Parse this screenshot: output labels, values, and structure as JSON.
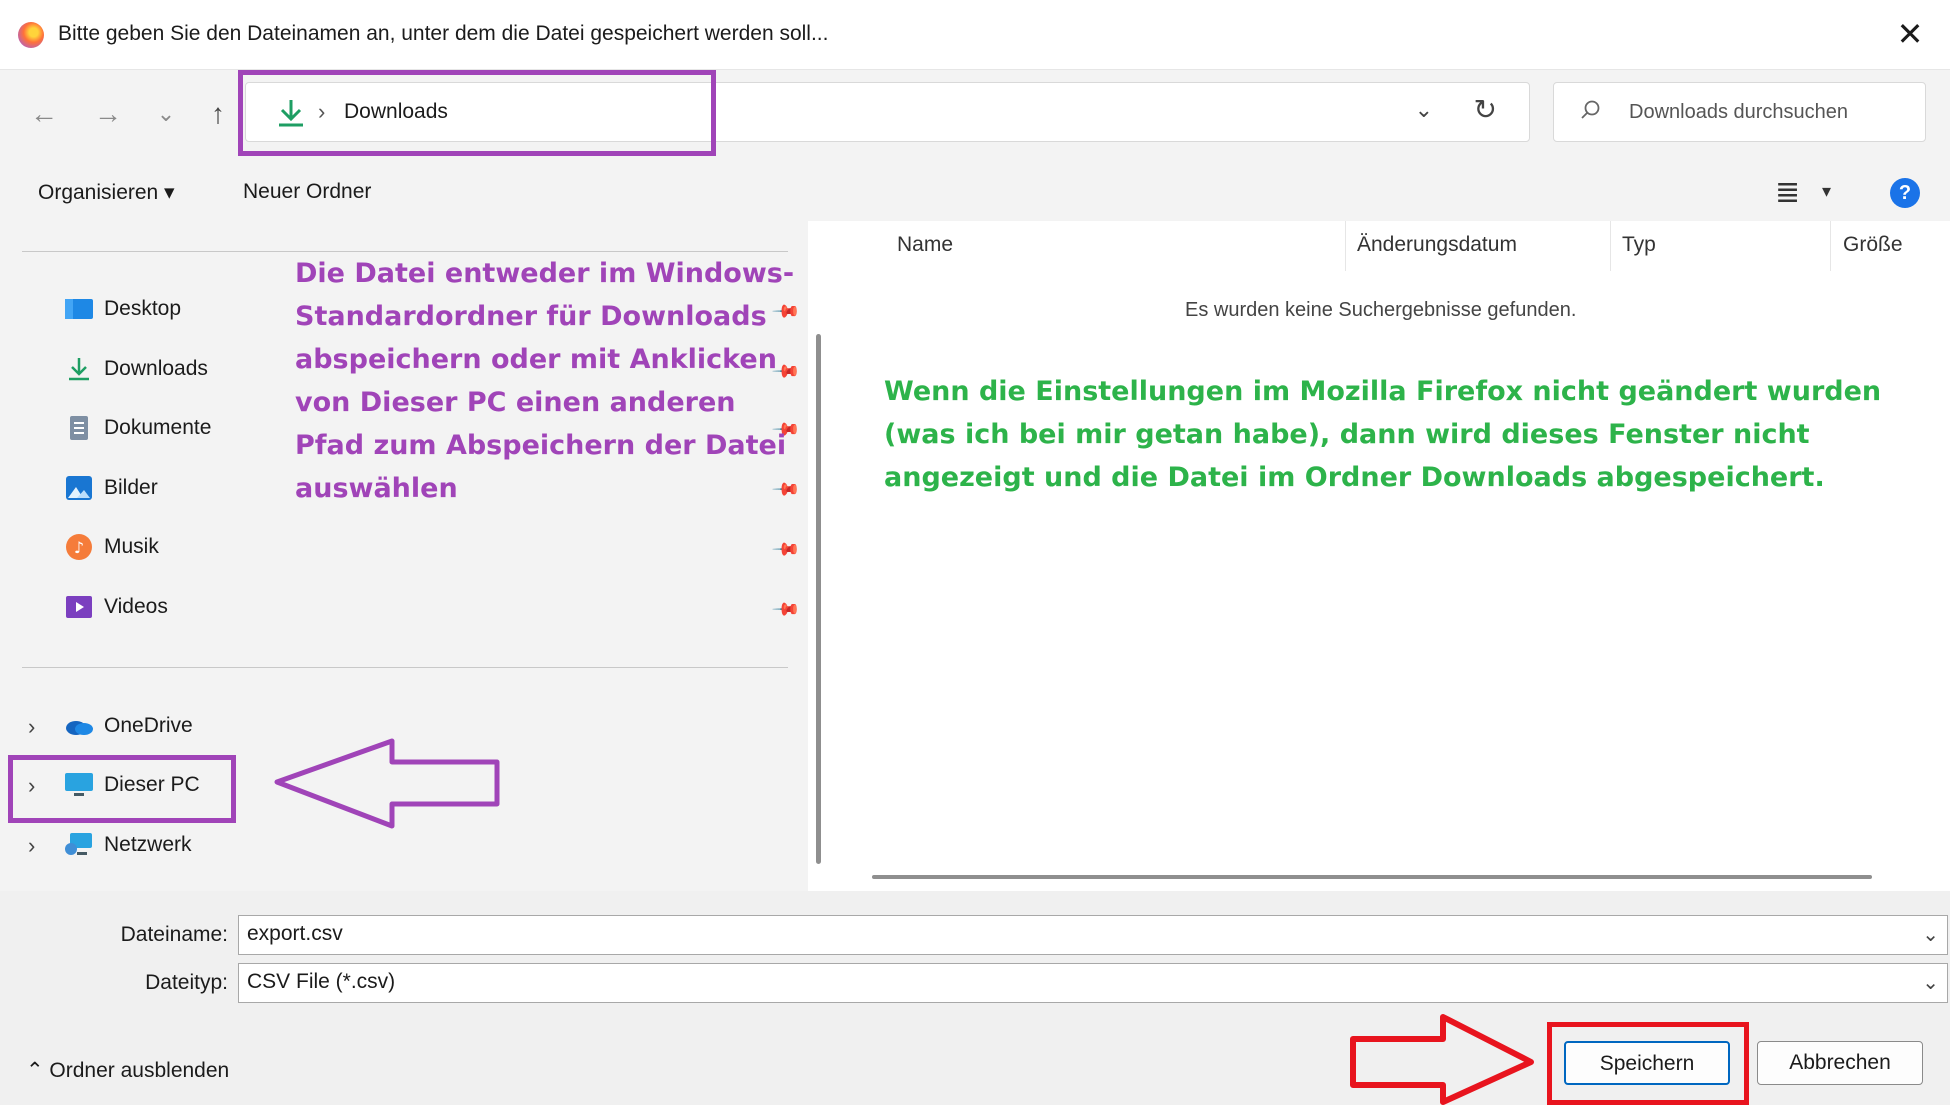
{
  "window": {
    "title": "Bitte geben Sie den Dateinamen an, unter dem die Datei gespeichert werden soll...",
    "close_glyph": "✕"
  },
  "nav": {
    "back_glyph": "←",
    "forward_glyph": "→",
    "recent_glyph": "⌄",
    "up_glyph": "↑",
    "breadcrumb_sep": "›",
    "breadcrumb": "Downloads",
    "dropdown_glyph": "⌄",
    "refresh_glyph": "↻",
    "search_placeholder": "Downloads durchsuchen"
  },
  "toolbar": {
    "organize_label": "Organisieren ▾",
    "new_folder_label": "Neuer Ordner",
    "view_glyph": "≣",
    "view_dropdown_glyph": "▾",
    "help_glyph": "?"
  },
  "sidebar": {
    "quick_access": [
      {
        "label": "Desktop",
        "icon": "desktop-icon"
      },
      {
        "label": "Downloads",
        "icon": "download-icon"
      },
      {
        "label": "Dokumente",
        "icon": "document-icon"
      },
      {
        "label": "Bilder",
        "icon": "pictures-icon"
      },
      {
        "label": "Musik",
        "icon": "music-icon"
      },
      {
        "label": "Videos",
        "icon": "videos-icon"
      }
    ],
    "locations": [
      {
        "label": "OneDrive",
        "icon": "onedrive-icon"
      },
      {
        "label": "Dieser PC",
        "icon": "computer-icon"
      },
      {
        "label": "Netzwerk",
        "icon": "network-icon"
      }
    ],
    "chevron_glyph": "›",
    "pin_glyph": "📌"
  },
  "file_list": {
    "columns": [
      "Name",
      "Änderungsdatum",
      "Typ",
      "Größe"
    ],
    "empty_message": "Es wurden keine Suchergebnisse gefunden."
  },
  "form": {
    "filename_label": "Dateiname:",
    "filename_value": "export.csv",
    "filetype_label": "Dateityp:",
    "filetype_value": "CSV File (*.csv)",
    "dropdown_glyph": "⌄"
  },
  "footer": {
    "hide_folders_label": "⌃  Ordner ausblenden",
    "save_label": "Speichern",
    "cancel_label": "Abbrechen"
  },
  "annotations": {
    "purple_note": [
      "Die Datei entweder im Windows-",
      "Standardordner für Downloads",
      "abspeichern oder mit Anklicken",
      "von Dieser PC einen anderen",
      "Pfad zum Abspeichern der Datei",
      "auswählen"
    ],
    "green_note": [
      "Wenn die Einstellungen im Mozilla Firefox nicht geändert wurden",
      "(was ich bei mir getan habe), dann wird dieses Fenster nicht",
      "angezeigt und die Datei im Ordner Downloads abgespeichert."
    ],
    "purple_color": "#a044b8",
    "green_color": "#2db34a",
    "red_color": "#e8141e"
  }
}
